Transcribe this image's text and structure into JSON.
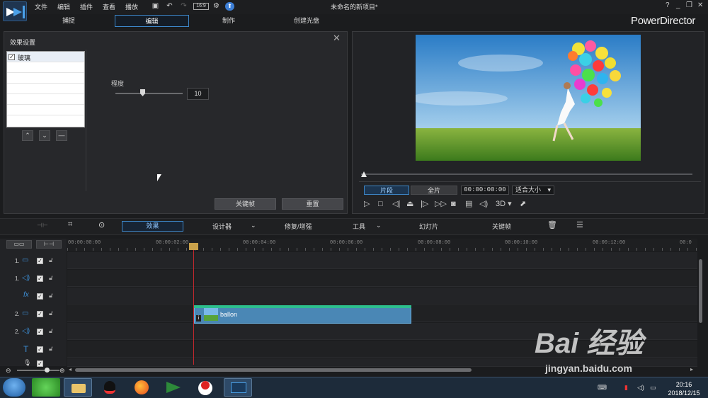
{
  "menu": {
    "items": [
      "文件",
      "编辑",
      "插件",
      "查看",
      "播放"
    ],
    "project_title": "未命名的新项目*"
  },
  "tabs": [
    "捕捉",
    "编辑",
    "制作",
    "创建光盘"
  ],
  "active_tab": "编辑",
  "brand": "PowerDirector",
  "effect_panel": {
    "title": "效果设置",
    "effect_name": "玻璃",
    "effect_checked": true,
    "param_label": "程度",
    "param_value": "10",
    "param_level": 0.4,
    "keyframe_label": "关键帧",
    "reset_label": "重置"
  },
  "preview": {
    "clip_label": "片段",
    "full_label": "全片",
    "timecode": "00:00:00:00",
    "fit_label": "适合大小",
    "mode_3d": "3D"
  },
  "toolbar": {
    "effect": "效果",
    "designer": "设计器",
    "fix": "修复/增强",
    "tools": "工具",
    "slideshow": "幻灯片",
    "keyframe": "关键帧"
  },
  "ruler": {
    "ticks": [
      "00:00:00:00",
      "00:00:02:00",
      "00:00:04:00",
      "00:00:06:00",
      "00:00:08:00",
      "00:00:10:00",
      "00:00:12:00",
      "00:0"
    ]
  },
  "tracks": [
    {
      "num": "1.",
      "icon": "video"
    },
    {
      "num": "1.",
      "icon": "audio"
    },
    {
      "num": "",
      "icon": "fx",
      "glyph": "fx"
    },
    {
      "num": "2.",
      "icon": "video"
    },
    {
      "num": "2.",
      "icon": "audio"
    },
    {
      "num": "",
      "icon": "title",
      "glyph": "T"
    },
    {
      "num": "",
      "icon": "voice"
    }
  ],
  "clip": {
    "name": "ballon"
  },
  "clock": {
    "time": "20:16",
    "date": "2018/12/15"
  },
  "watermark": {
    "text": "Bai 经验",
    "url": "jingyan.baidu.com"
  }
}
